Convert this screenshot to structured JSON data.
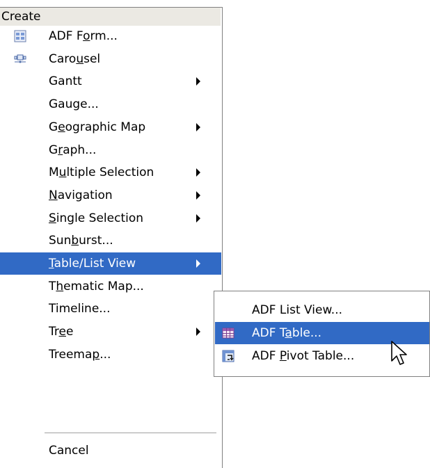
{
  "menu": {
    "header": "Create",
    "items": [
      {
        "pre": "ADF F",
        "ul": "o",
        "post": "rm...",
        "icon": "adf-form-icon",
        "submenu": false
      },
      {
        "pre": "Caro",
        "ul": "u",
        "post": "sel",
        "icon": "carousel-icon",
        "submenu": false
      },
      {
        "pre": "Gantt",
        "ul": "",
        "post": "",
        "icon": "",
        "submenu": true
      },
      {
        "pre": "Gauge...",
        "ul": "",
        "post": "",
        "icon": "",
        "submenu": false
      },
      {
        "pre": "G",
        "ul": "e",
        "post": "ographic Map",
        "icon": "",
        "submenu": true
      },
      {
        "pre": "G",
        "ul": "r",
        "post": "aph...",
        "icon": "",
        "submenu": false
      },
      {
        "pre": "M",
        "ul": "u",
        "post": "ltiple Selection",
        "icon": "",
        "submenu": true
      },
      {
        "pre": "",
        "ul": "N",
        "post": "avigation",
        "icon": "",
        "submenu": true
      },
      {
        "pre": "",
        "ul": "S",
        "post": "ingle Selection",
        "icon": "",
        "submenu": true
      },
      {
        "pre": "Sun",
        "ul": "b",
        "post": "urst...",
        "icon": "",
        "submenu": false
      },
      {
        "pre": "",
        "ul": "T",
        "post": "able/List View",
        "icon": "",
        "submenu": true,
        "selected": true
      },
      {
        "pre": "T",
        "ul": "h",
        "post": "ematic Map...",
        "icon": "",
        "submenu": false
      },
      {
        "pre": "Timeline...",
        "ul": "",
        "post": "",
        "icon": "",
        "submenu": false
      },
      {
        "pre": "Tr",
        "ul": "e",
        "post": "e",
        "icon": "",
        "submenu": true
      },
      {
        "pre": "Treema",
        "ul": "p",
        "post": "...",
        "icon": "",
        "submenu": false
      }
    ],
    "cancel": "Cancel"
  },
  "submenu": {
    "items": [
      {
        "pre": "ADF List View...",
        "ul": "",
        "post": "",
        "icon": ""
      },
      {
        "pre": "ADF T",
        "ul": "a",
        "post": "ble...",
        "icon": "adf-table-icon",
        "selected": true
      },
      {
        "pre": "ADF ",
        "ul": "P",
        "post": "ivot Table...",
        "icon": "pivot-table-icon"
      }
    ]
  },
  "colors": {
    "selection": "#316ac5",
    "header_bg": "#ebe9e3"
  }
}
